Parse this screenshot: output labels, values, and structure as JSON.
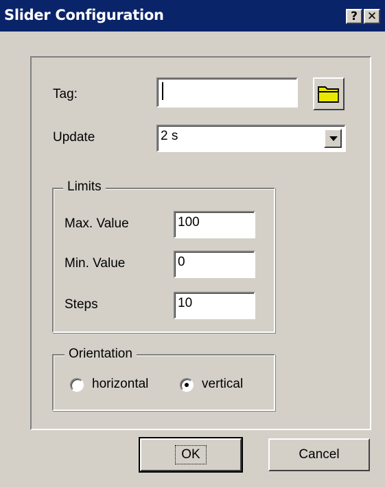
{
  "window": {
    "title": "Slider Configuration",
    "help_label": "?",
    "close_label": "✕"
  },
  "tag": {
    "label": "Tag:",
    "value": ""
  },
  "browse_icon": "folder-icon",
  "update": {
    "label": "Update",
    "value": "2 s"
  },
  "limits": {
    "title": "Limits",
    "max_label": "Max. Value",
    "max_value": "100",
    "min_label": "Min. Value",
    "min_value": "0",
    "steps_label": "Steps",
    "steps_value": "10"
  },
  "orientation": {
    "title": "Orientation",
    "options": [
      {
        "label": "horizontal",
        "selected": false
      },
      {
        "label": "vertical",
        "selected": true
      }
    ]
  },
  "buttons": {
    "ok": "OK",
    "cancel": "Cancel"
  },
  "colors": {
    "titlebar": "#0a246a",
    "face": "#d4d0c8",
    "folder": "#e8e800"
  }
}
